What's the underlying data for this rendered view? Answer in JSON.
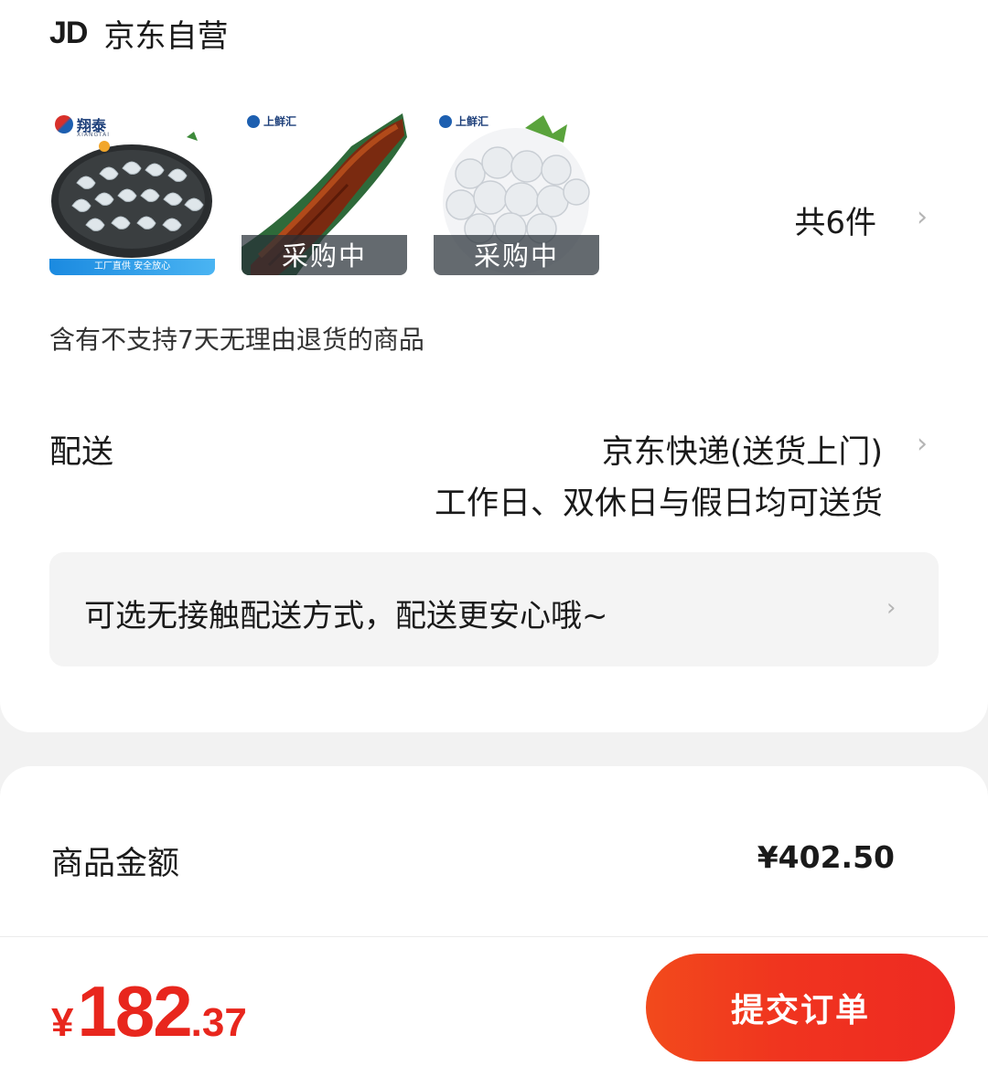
{
  "store": {
    "logo_text": "JD",
    "name": "京东自营"
  },
  "products": [
    {
      "brand": "翔泰",
      "brand_sub": "XIANGTAI",
      "badge": "工厂直供 安全放心"
    },
    {
      "brand": "上鲜汇",
      "status": "采购中"
    },
    {
      "brand": "上鲜汇",
      "status": "采购中"
    }
  ],
  "item_count_label": "共6件",
  "return_notice": "含有不支持7天无理由退货的商品",
  "shipping": {
    "label": "配送",
    "method": "京东快递(送货上门)",
    "time": "工作日、双休日与假日均可送货"
  },
  "contactless": {
    "text": "可选无接触配送方式，配送更安心哦~"
  },
  "summary": {
    "amount_label": "商品金额",
    "amount_value": "¥402.50"
  },
  "footer": {
    "currency": "¥",
    "total_int": "182",
    "total_dec": ".37",
    "submit_label": "提交订单"
  },
  "colors": {
    "accent": "#e8261d",
    "button_gradient_start": "#f24a1c",
    "button_gradient_end": "#ee2a22",
    "chevron": "#b5b5b5"
  },
  "icons": {
    "chevron": "chevron-right-icon"
  }
}
